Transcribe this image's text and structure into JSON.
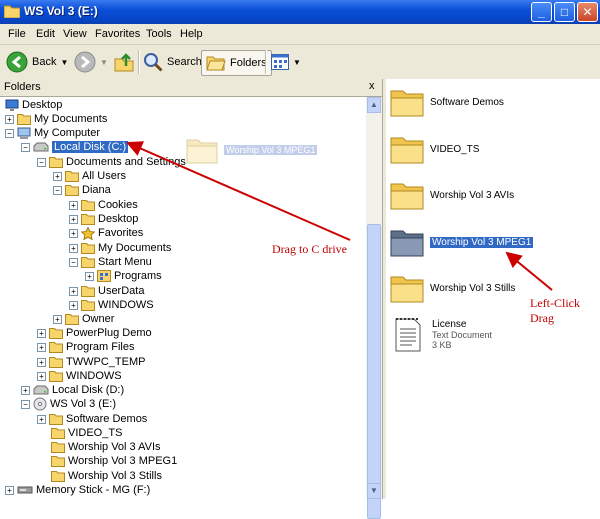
{
  "window": {
    "title": "WS Vol 3 (E:)"
  },
  "menu": [
    "File",
    "Edit",
    "View",
    "Favorites",
    "Tools",
    "Help"
  ],
  "toolbar": {
    "back_label": "Back",
    "search_label": "Search",
    "folders_label": "Folders"
  },
  "folders_pane": {
    "header": "Folders",
    "close_glyph": "x"
  },
  "tree": [
    {
      "label": "Desktop",
      "icon": "desktop-icon"
    },
    {
      "label": "My Documents",
      "icon": "folder-icon"
    },
    {
      "label": "My Computer",
      "icon": "computer-icon"
    },
    {
      "label": "Local Disk (C:)",
      "icon": "drive-icon",
      "selected": true
    },
    {
      "label": "Documents and Settings",
      "icon": "folder-icon"
    },
    {
      "label": "All Users",
      "icon": "folder-icon"
    },
    {
      "label": "Diana",
      "icon": "folder-icon"
    },
    {
      "label": "Cookies",
      "icon": "folder-icon"
    },
    {
      "label": "Desktop",
      "icon": "folder-icon"
    },
    {
      "label": "Favorites",
      "icon": "favorites-icon"
    },
    {
      "label": "My Documents",
      "icon": "folder-icon"
    },
    {
      "label": "Start Menu",
      "icon": "folder-icon"
    },
    {
      "label": "Programs",
      "icon": "programs-icon"
    },
    {
      "label": "UserData",
      "icon": "folder-icon"
    },
    {
      "label": "WINDOWS",
      "icon": "folder-icon"
    },
    {
      "label": "Owner",
      "icon": "folder-icon"
    },
    {
      "label": "PowerPlug Demo",
      "icon": "folder-icon"
    },
    {
      "label": "Program Files",
      "icon": "folder-icon"
    },
    {
      "label": "TWWPC_TEMP",
      "icon": "folder-icon"
    },
    {
      "label": "WINDOWS",
      "icon": "folder-icon"
    },
    {
      "label": "Local Disk (D:)",
      "icon": "drive-icon"
    },
    {
      "label": "WS Vol 3 (E:)",
      "icon": "cd-drive-icon"
    },
    {
      "label": "Software Demos",
      "icon": "folder-icon"
    },
    {
      "label": "VIDEO_TS",
      "icon": "folder-icon"
    },
    {
      "label": "Worship Vol 3 AVIs",
      "icon": "folder-icon"
    },
    {
      "label": "Worship Vol 3 MPEG1",
      "icon": "folder-icon"
    },
    {
      "label": "Worship Vol 3 Stills",
      "icon": "folder-icon"
    },
    {
      "label": "Memory Stick - MG (F:)",
      "icon": "memory-stick-icon"
    }
  ],
  "content_items": [
    {
      "name": "Software Demos",
      "type": "folder"
    },
    {
      "name": "VIDEO_TS",
      "type": "folder"
    },
    {
      "name": "Worship Vol 3 AVIs",
      "type": "folder"
    },
    {
      "name": "Worship Vol 3 MPEG1",
      "type": "folder",
      "selected": true
    },
    {
      "name": "Worship Vol 3 Stills",
      "type": "folder"
    },
    {
      "name": "License",
      "type": "text",
      "subtitle": "Text Document",
      "size": "3 KB"
    }
  ],
  "drag_ghost": {
    "label": "Worship Vol 3 MPEG1"
  },
  "annotations": {
    "drag_to": "Drag to C drive",
    "left_click_1": "Left-Click",
    "left_click_2": "Drag",
    "color": "#cc0000"
  }
}
